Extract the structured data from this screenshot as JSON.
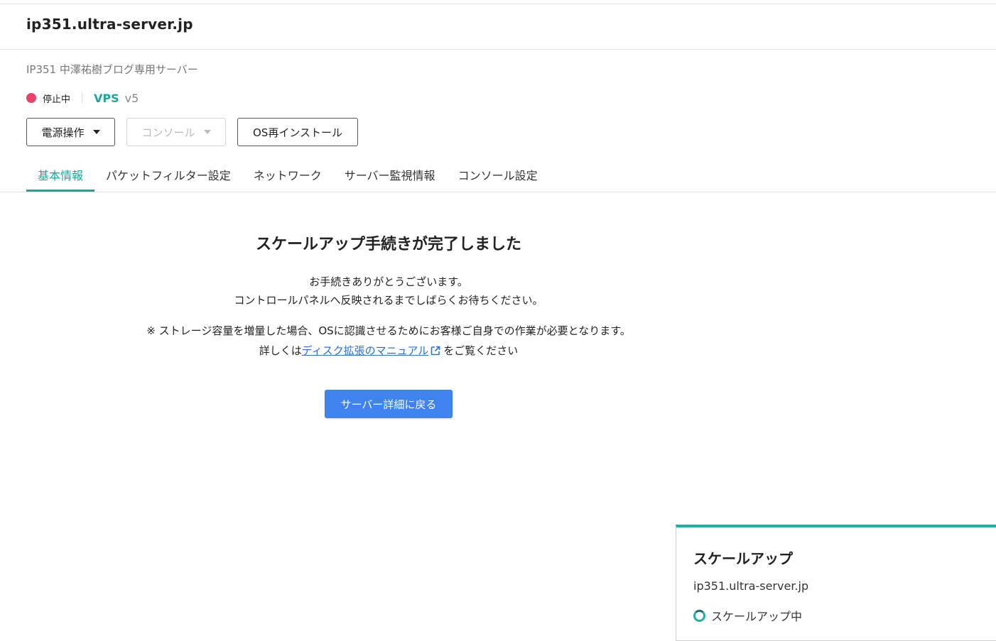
{
  "header": {
    "hostname": "ip351.ultra-server.jp"
  },
  "server": {
    "label": "IP351 中澤祐樹ブログ専用サーバー",
    "status": "停止中",
    "status_color": "#e8416a",
    "plan": "VPS",
    "plan_version": "v5",
    "plan_color": "#1aa89a"
  },
  "actions": {
    "power_label": "電源操作",
    "console_label": "コンソール",
    "reinstall_label": "OS再インストール"
  },
  "tabs": [
    {
      "label": "基本情報",
      "active": true
    },
    {
      "label": "パケットフィルター設定",
      "active": false
    },
    {
      "label": "ネットワーク",
      "active": false
    },
    {
      "label": "サーバー監視情報",
      "active": false
    },
    {
      "label": "コンソール設定",
      "active": false
    }
  ],
  "completion": {
    "title": "スケールアップ手続きが完了しました",
    "line1": "お手続きありがとうございます。",
    "line2": "コントロールパネルへ反映されるまでしばらくお待ちください。",
    "note": "※ ストレージ容量を増量した場合、OSに認識させるためにお客様ご自身での作業が必要となります。",
    "detail_prefix": "詳しくは",
    "detail_link": "ディスク拡張のマニュアル",
    "detail_suffix": "をご覧ください",
    "back_button": "サーバー詳細に戻る",
    "link_color": "#2b6fd6",
    "button_color": "#3f84ee"
  },
  "toast": {
    "title": "スケールアップ",
    "hostname": "ip351.ultra-server.jp",
    "status": "スケールアップ中",
    "accent_color": "#1fb2a2",
    "status_icon": "spinner-icon"
  }
}
